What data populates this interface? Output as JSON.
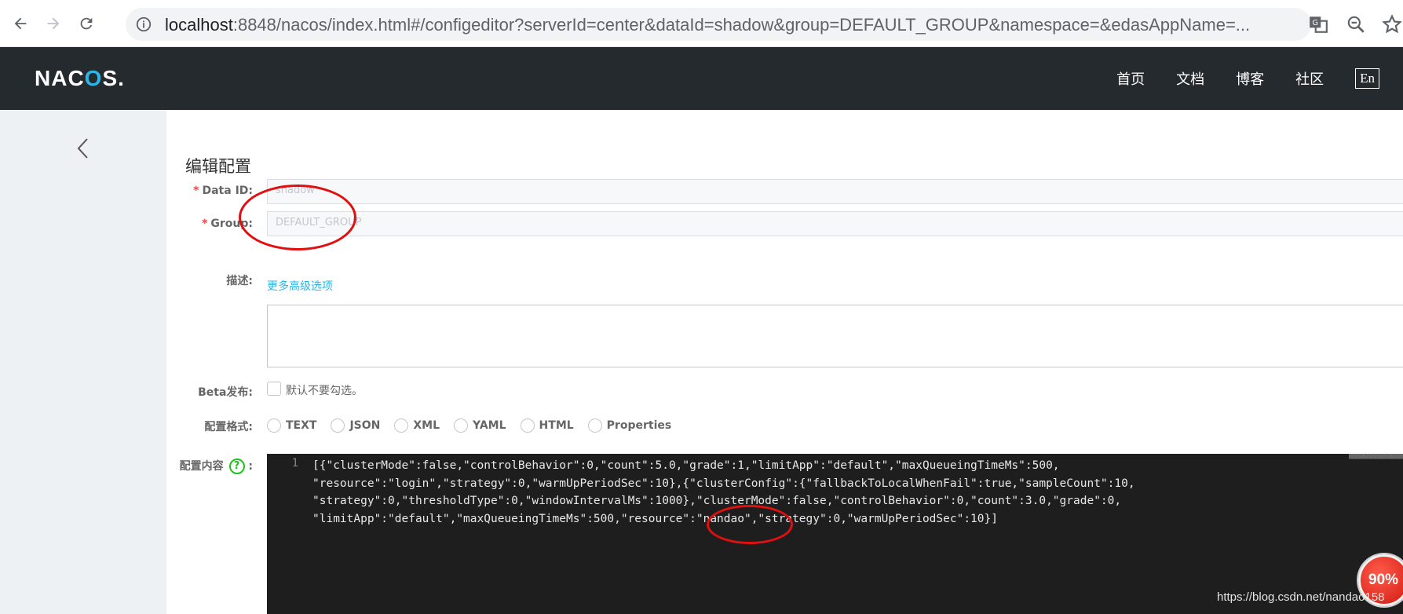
{
  "browser": {
    "url_host": "localhost",
    "url_rest": ":8848/nacos/index.html#/configeditor?serverId=center&dataId=shadow&group=DEFAULT_GROUP&namespace=&edasAppName=..."
  },
  "header": {
    "logo_text_a": "NAC",
    "logo_text_o": "O",
    "logo_text_b": "S.",
    "nav": [
      "首页",
      "文档",
      "博客",
      "社区"
    ],
    "lang": "En"
  },
  "main": {
    "title": "编辑配置",
    "data_id_label": "Data ID:",
    "data_id_value": "shadow",
    "group_label": "Group:",
    "group_value": "DEFAULT_GROUP",
    "more_options": "更多高级选项",
    "desc_label": "描述:",
    "beta_label": "Beta发布:",
    "beta_checkbox_label": "默认不要勾选。",
    "format_label": "配置格式:",
    "formats": [
      "TEXT",
      "JSON",
      "XML",
      "YAML",
      "HTML",
      "Properties"
    ],
    "content_label": "配置内容",
    "content_colon": ":",
    "help_glyph": "?"
  },
  "editor": {
    "line_number": "1",
    "lines": [
      "[{\"clusterMode\":false,\"controlBehavior\":0,\"count\":5.0,\"grade\":1,\"limitApp\":\"default\",\"maxQueueingTimeMs\":500,",
      "\"resource\":\"login\",\"strategy\":0,\"warmUpPeriodSec\":10},{\"clusterConfig\":{\"fallbackToLocalWhenFail\":true,\"sampleCount\":10,",
      "\"strategy\":0,\"thresholdType\":0,\"windowIntervalMs\":1000},\"clusterMode\":false,\"controlBehavior\":0,\"count\":3.0,\"grade\":0,",
      "\"limitApp\":\"default\",\"maxQueueingTimeMs\":500,\"resource\":\"nandao\",\"strategy\":0,\"warmUpPeriodSec\":10}]"
    ]
  },
  "overlay": {
    "progress": "90%",
    "watermark": "https://blog.csdn.net/nandao158"
  },
  "colors": {
    "header_bg": "#252a2f",
    "accent": "#2bb7e5",
    "required": "#f14545",
    "annotation": "#e01010"
  }
}
